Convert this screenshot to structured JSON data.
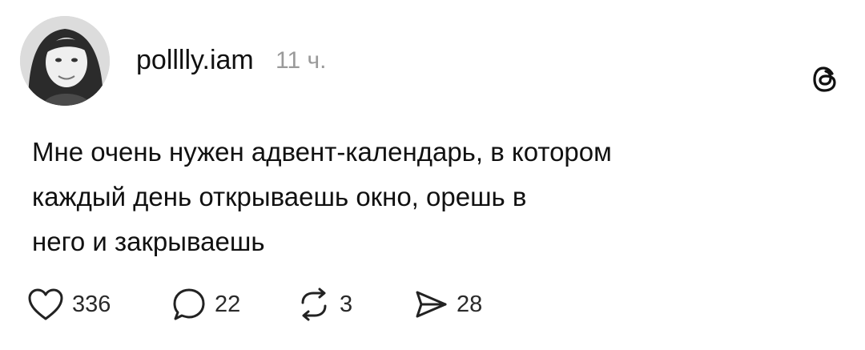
{
  "post": {
    "username": "polllly.iam",
    "time": "11 ч.",
    "text_lines": [
      "Мне очень нужен адвент-календарь, в котором",
      "каждый день открываешь окно, орешь в",
      "него и закрываешь"
    ]
  },
  "actions": {
    "like": {
      "icon": "heart-icon",
      "count": "336"
    },
    "comment": {
      "icon": "comment-bubble-icon",
      "count": "22"
    },
    "repost": {
      "icon": "repost-icon",
      "count": "3"
    },
    "share": {
      "icon": "send-icon",
      "count": "28"
    }
  },
  "colors": {
    "text": "#111111",
    "muted": "#9a9a9a",
    "background": "#ffffff"
  }
}
